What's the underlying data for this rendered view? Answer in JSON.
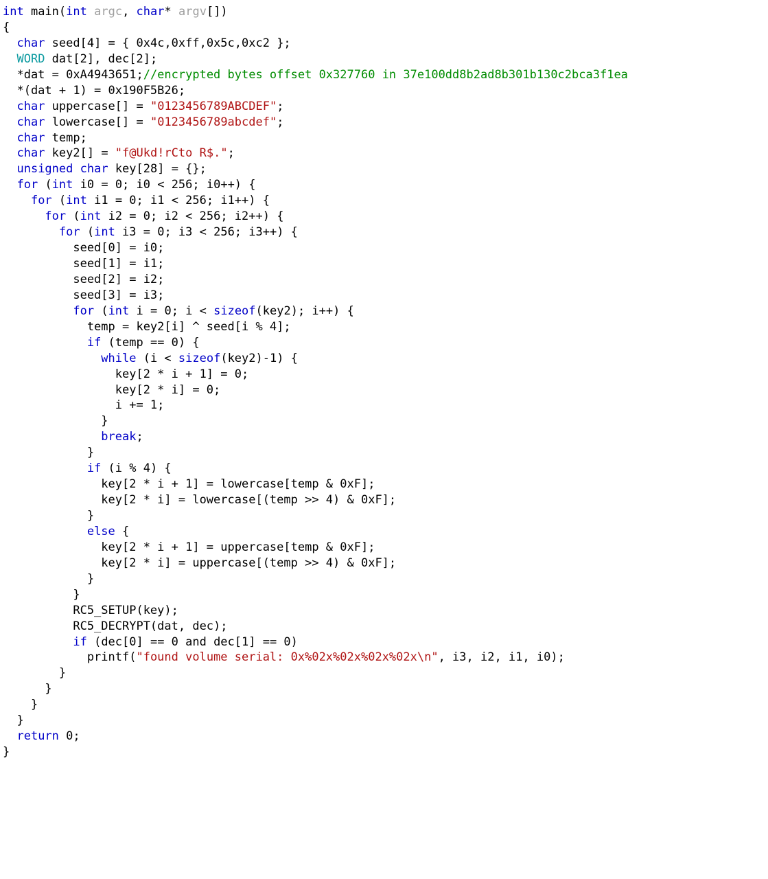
{
  "code": {
    "lines": [
      [
        [
          "kw",
          "int"
        ],
        [
          "op",
          " main("
        ],
        [
          "kw",
          "int"
        ],
        [
          "op",
          " "
        ],
        [
          "id-dim",
          "argc"
        ],
        [
          "op",
          ", "
        ],
        [
          "kw",
          "char"
        ],
        [
          "op",
          "* "
        ],
        [
          "id-dim",
          "argv"
        ],
        [
          "op",
          "[])"
        ]
      ],
      [
        [
          "op",
          "{"
        ]
      ],
      [
        [
          "op",
          "  "
        ],
        [
          "kw",
          "char"
        ],
        [
          "op",
          " seed[4] = { 0x4c,0xff,0x5c,0xc2 };"
        ]
      ],
      [
        [
          "op",
          "  "
        ],
        [
          "ty",
          "WORD"
        ],
        [
          "op",
          " dat[2], dec[2];"
        ]
      ],
      [
        [
          "op",
          "  *dat = 0xA4943651;"
        ],
        [
          "cm",
          "//encrypted bytes offset 0x327760 in 37e100dd8b2ad8b301b130c2bca3f1ea"
        ]
      ],
      [
        [
          "op",
          "  *(dat + 1) = 0x190F5B26;"
        ]
      ],
      [
        [
          "op",
          "  "
        ],
        [
          "kw",
          "char"
        ],
        [
          "op",
          " uppercase[] = "
        ],
        [
          "str",
          "\"0123456789ABCDEF\""
        ],
        [
          "op",
          ";"
        ]
      ],
      [
        [
          "op",
          "  "
        ],
        [
          "kw",
          "char"
        ],
        [
          "op",
          " lowercase[] = "
        ],
        [
          "str",
          "\"0123456789abcdef\""
        ],
        [
          "op",
          ";"
        ]
      ],
      [
        [
          "op",
          "  "
        ],
        [
          "kw",
          "char"
        ],
        [
          "op",
          " temp;"
        ]
      ],
      [
        [
          "op",
          "  "
        ],
        [
          "kw",
          "char"
        ],
        [
          "op",
          " key2[] = "
        ],
        [
          "str",
          "\"f@Ukd!rCto R$.\""
        ],
        [
          "op",
          ";"
        ]
      ],
      [
        [
          "op",
          "  "
        ],
        [
          "kw",
          "unsigned"
        ],
        [
          "op",
          " "
        ],
        [
          "kw",
          "char"
        ],
        [
          "op",
          " key[28] = {};"
        ]
      ],
      [
        [
          "op",
          "  "
        ],
        [
          "kw",
          "for"
        ],
        [
          "op",
          " ("
        ],
        [
          "kw",
          "int"
        ],
        [
          "op",
          " i0 = 0; i0 < 256; i0++) {"
        ]
      ],
      [
        [
          "op",
          "    "
        ],
        [
          "kw",
          "for"
        ],
        [
          "op",
          " ("
        ],
        [
          "kw",
          "int"
        ],
        [
          "op",
          " i1 = 0; i1 < 256; i1++) {"
        ]
      ],
      [
        [
          "op",
          "      "
        ],
        [
          "kw",
          "for"
        ],
        [
          "op",
          " ("
        ],
        [
          "kw",
          "int"
        ],
        [
          "op",
          " i2 = 0; i2 < 256; i2++) {"
        ]
      ],
      [
        [
          "op",
          "        "
        ],
        [
          "kw",
          "for"
        ],
        [
          "op",
          " ("
        ],
        [
          "kw",
          "int"
        ],
        [
          "op",
          " i3 = 0; i3 < 256; i3++) {"
        ]
      ],
      [
        [
          "op",
          "          seed[0] = i0;"
        ]
      ],
      [
        [
          "op",
          "          seed[1] = i1;"
        ]
      ],
      [
        [
          "op",
          "          seed[2] = i2;"
        ]
      ],
      [
        [
          "op",
          "          seed[3] = i3;"
        ]
      ],
      [
        [
          "op",
          "          "
        ],
        [
          "kw",
          "for"
        ],
        [
          "op",
          " ("
        ],
        [
          "kw",
          "int"
        ],
        [
          "op",
          " i = 0; i < "
        ],
        [
          "kw",
          "sizeof"
        ],
        [
          "op",
          "(key2); i++) {"
        ]
      ],
      [
        [
          "op",
          "            temp = key2[i] ^ seed[i % 4];"
        ]
      ],
      [
        [
          "op",
          "            "
        ],
        [
          "kw",
          "if"
        ],
        [
          "op",
          " (temp == 0) {"
        ]
      ],
      [
        [
          "op",
          "              "
        ],
        [
          "kw",
          "while"
        ],
        [
          "op",
          " (i < "
        ],
        [
          "kw",
          "sizeof"
        ],
        [
          "op",
          "(key2)-1) {"
        ]
      ],
      [
        [
          "op",
          "                key[2 * i + 1] = 0;"
        ]
      ],
      [
        [
          "op",
          "                key[2 * i] = 0;"
        ]
      ],
      [
        [
          "op",
          "                i += 1;"
        ]
      ],
      [
        [
          "op",
          "              }"
        ]
      ],
      [
        [
          "op",
          "              "
        ],
        [
          "kw",
          "break"
        ],
        [
          "op",
          ";"
        ]
      ],
      [
        [
          "op",
          "            }"
        ]
      ],
      [
        [
          "op",
          "            "
        ],
        [
          "kw",
          "if"
        ],
        [
          "op",
          " (i % 4) {"
        ]
      ],
      [
        [
          "op",
          "              key[2 * i + 1] = lowercase[temp & 0xF];"
        ]
      ],
      [
        [
          "op",
          "              key[2 * i] = lowercase[(temp >> 4) & 0xF];"
        ]
      ],
      [
        [
          "op",
          "            }"
        ]
      ],
      [
        [
          "op",
          "            "
        ],
        [
          "kw",
          "else"
        ],
        [
          "op",
          " {"
        ]
      ],
      [
        [
          "op",
          "              key[2 * i + 1] = uppercase[temp & 0xF];"
        ]
      ],
      [
        [
          "op",
          "              key[2 * i] = uppercase[(temp >> 4) & 0xF];"
        ]
      ],
      [
        [
          "op",
          "            }"
        ]
      ],
      [
        [
          "op",
          "          }"
        ]
      ],
      [
        [
          "op",
          "          RC5_SETUP(key);"
        ]
      ],
      [
        [
          "op",
          "          RC5_DECRYPT(dat, dec);"
        ]
      ],
      [
        [
          "op",
          "          "
        ],
        [
          "kw",
          "if"
        ],
        [
          "op",
          " (dec[0] == 0 and dec[1] == 0)"
        ]
      ],
      [
        [
          "op",
          "            printf("
        ],
        [
          "str",
          "\"found volume serial: 0x%02x%02x%02x%02x\\n\""
        ],
        [
          "op",
          ", i3, i2, i1, i0);"
        ]
      ],
      [
        [
          "op",
          "        }"
        ]
      ],
      [
        [
          "op",
          "      }"
        ]
      ],
      [
        [
          "op",
          "    }"
        ]
      ],
      [
        [
          "op",
          "  }"
        ]
      ],
      [
        [
          "op",
          "  "
        ],
        [
          "kw",
          "return"
        ],
        [
          "op",
          " 0;"
        ]
      ],
      [
        [
          "op",
          "}"
        ]
      ]
    ]
  }
}
